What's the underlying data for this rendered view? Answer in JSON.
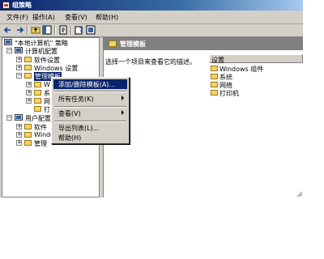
{
  "window": {
    "title": "组策略"
  },
  "menu": [
    "文件(F)",
    "操作(A)",
    "查看(V)",
    "帮助(H)"
  ],
  "toolbar": [
    "back-icon",
    "forward-icon",
    "up-folder-icon",
    "show-tree-icon",
    "properties-icon",
    "help-icon",
    "export-icon"
  ],
  "tree": {
    "root": "\"本地计算机\" 策略",
    "computer_config": "计算机配置",
    "software_settings": "软件设置",
    "windows_settings": "Windows 设置",
    "admin_templates": "管理模板",
    "admin_children": [
      "W",
      "系",
      "网",
      "打"
    ],
    "user_config": "用户配置",
    "user_software": "软件",
    "user_windows": "Windo",
    "user_admin": "管理"
  },
  "right": {
    "title": "管理模板",
    "description": "选择一个项目来查看它的描述。",
    "column_header": "设置",
    "items": [
      "Windows 组件",
      "系统",
      "网络",
      "打印机"
    ]
  },
  "context_menu": {
    "items": [
      "添加/删除模板(A)...",
      "所有任务(K)",
      "查看(V)",
      "导出列表(L)...",
      "帮助(H)"
    ]
  }
}
